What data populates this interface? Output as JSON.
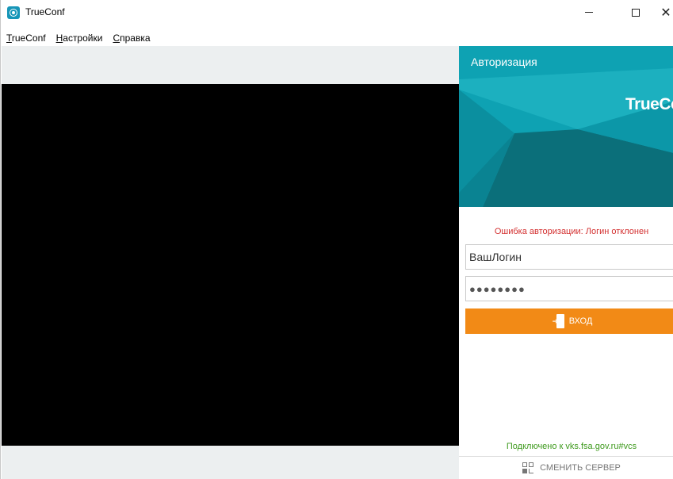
{
  "window": {
    "title": "TrueConf"
  },
  "menu": {
    "items": [
      {
        "underline": "T",
        "rest": "rueConf"
      },
      {
        "underline": "Н",
        "rest": "астройки"
      },
      {
        "underline": "С",
        "rest": "правка"
      }
    ]
  },
  "auth": {
    "header": "Авторизация",
    "logo_text": "TrueConf",
    "error": "Ошибка авторизации: Логин отклонен",
    "login_value": "ВашЛогин",
    "password_mask": "●●●●●●●●",
    "login_button": "ВХОД",
    "status": "Подключено к vks.fsa.gov.ru#vcs",
    "change_server": "СМЕНИТЬ СЕРВЕР"
  },
  "colors": {
    "accent_orange": "#f28a16",
    "banner_teal": "#0ea2b3",
    "error_red": "#d32f2f",
    "status_green": "#3e9a1d"
  },
  "icons": {
    "app": "trueconf-icon",
    "login": "door-enter-icon",
    "change_server": "server-switch-icon"
  }
}
